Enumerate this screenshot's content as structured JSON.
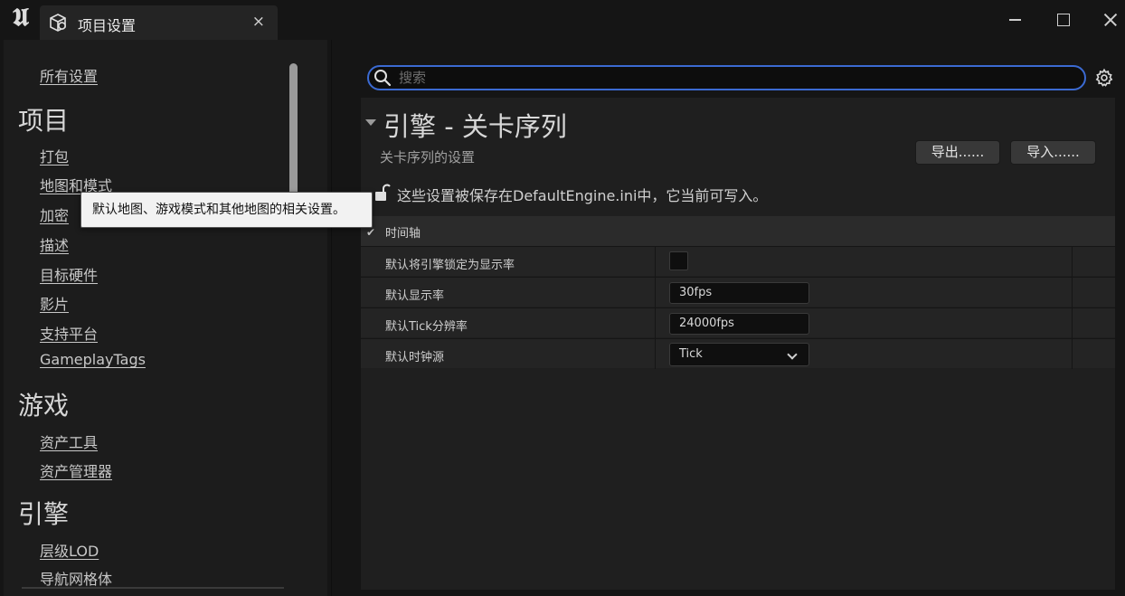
{
  "window": {
    "tab_title": "项目设置",
    "tab_close": "×"
  },
  "sidebar": {
    "all_settings": "所有设置",
    "sections": [
      {
        "title": "项目",
        "items": [
          "打包",
          "地图和模式",
          "加密",
          "描述",
          "目标硬件",
          "影片",
          "支持平台",
          "GameplayTags"
        ]
      },
      {
        "title": "游戏",
        "items": [
          "资产工具",
          "资产管理器"
        ]
      },
      {
        "title": "引擎",
        "items": [
          "层级LOD",
          "导航网格体"
        ]
      }
    ],
    "tooltip": "默认地图、游戏模式和其他地图的相关设置。"
  },
  "search": {
    "placeholder": "搜索",
    "value": ""
  },
  "panel": {
    "title": "引擎 - 关卡序列",
    "subtitle": "关卡序列的设置",
    "export_label": "导出......",
    "import_label": "导入......",
    "save_message": "这些设置被保存在DefaultEngine.ini中，它当前可写入。"
  },
  "category": {
    "label": "时间轴",
    "properties": [
      {
        "name": "默认将引擎锁定为显示率",
        "type": "checkbox",
        "checked": false
      },
      {
        "name": "默认显示率",
        "type": "text",
        "value": "30fps"
      },
      {
        "name": "默认Tick分辨率",
        "type": "text",
        "value": "24000fps"
      },
      {
        "name": "默认时钟源",
        "type": "select",
        "value": "Tick"
      }
    ]
  },
  "colors": {
    "accent": "#3b6ad2",
    "background": "#151515",
    "panel": "#1f1f1f"
  }
}
